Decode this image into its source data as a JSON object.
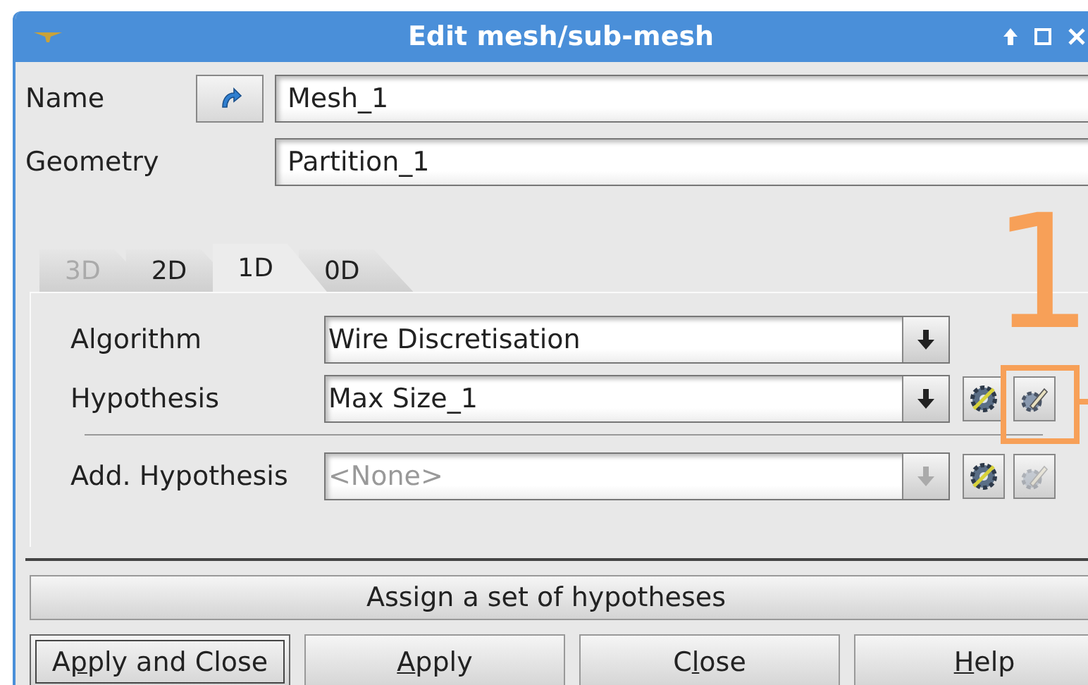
{
  "window": {
    "title": "Edit mesh/sub-mesh"
  },
  "name": {
    "label": "Name",
    "value": "Mesh_1"
  },
  "geometry": {
    "label": "Geometry",
    "value": "Partition_1"
  },
  "tabs": [
    {
      "label": "3D",
      "selected": false,
      "disabled": true
    },
    {
      "label": "2D",
      "selected": false,
      "disabled": false
    },
    {
      "label": "1D",
      "selected": true,
      "disabled": false
    },
    {
      "label": "0D",
      "selected": false,
      "disabled": false
    }
  ],
  "rows": [
    {
      "label": "Algorithm",
      "value": "Wire Discretisation",
      "disabled": false,
      "kind": "algorithm"
    },
    {
      "label": "Hypothesis",
      "value": "Max Size_1",
      "disabled": false,
      "kind": "hypothesis"
    },
    {
      "label": "Add. Hypothesis",
      "placeholder": "<None>",
      "disabled": true,
      "kind": "hypothesis"
    }
  ],
  "assign_button": "Assign a set of hypotheses",
  "buttons": [
    {
      "pre": "A",
      "key": "p",
      "post": "ply and Close",
      "default": true
    },
    {
      "key": "A",
      "post": "pply",
      "default": false
    },
    {
      "pre": "C",
      "key": "l",
      "post": "ose",
      "default": false
    },
    {
      "key": "H",
      "post": "elp",
      "default": false
    }
  ],
  "annotation": {
    "label": "1"
  }
}
